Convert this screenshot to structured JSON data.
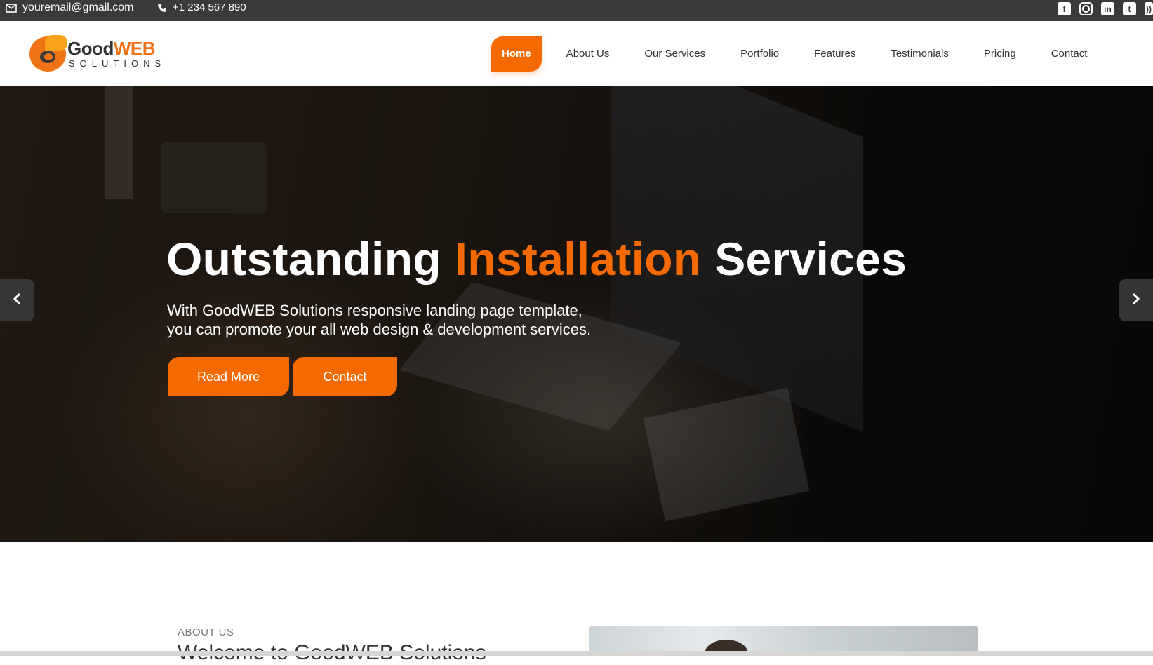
{
  "topbar": {
    "email": "youremail@gmail.com",
    "phone": "+1 234 567 890",
    "socials": [
      "facebook-icon",
      "instagram-icon",
      "linkedin-icon",
      "twitter-icon",
      "rss-icon"
    ]
  },
  "logo": {
    "brand_good": "Good",
    "brand_web": "WEB",
    "sub": "SOLUTIONS"
  },
  "nav": {
    "items": [
      {
        "label": "Home",
        "active": true
      },
      {
        "label": "About Us"
      },
      {
        "label": "Our Services"
      },
      {
        "label": "Portfolio"
      },
      {
        "label": "Features"
      },
      {
        "label": "Testimonials"
      },
      {
        "label": "Pricing"
      },
      {
        "label": "Contact"
      }
    ]
  },
  "hero": {
    "title_part1": "Outstanding",
    "title_accent": "Installation",
    "title_part2": "Services",
    "subtitle_line1": "With GoodWEB Solutions responsive landing page template,",
    "subtitle_line2": "you can promote your all web design & development services.",
    "btn_read_more": "Read More",
    "btn_contact": "Contact"
  },
  "about": {
    "label": "ABOUT US",
    "title": "Welcome to GoodWEB Solutions"
  },
  "colors": {
    "accent": "#f56a00",
    "topbar": "#3a3a3a",
    "text_dark": "#333333"
  }
}
